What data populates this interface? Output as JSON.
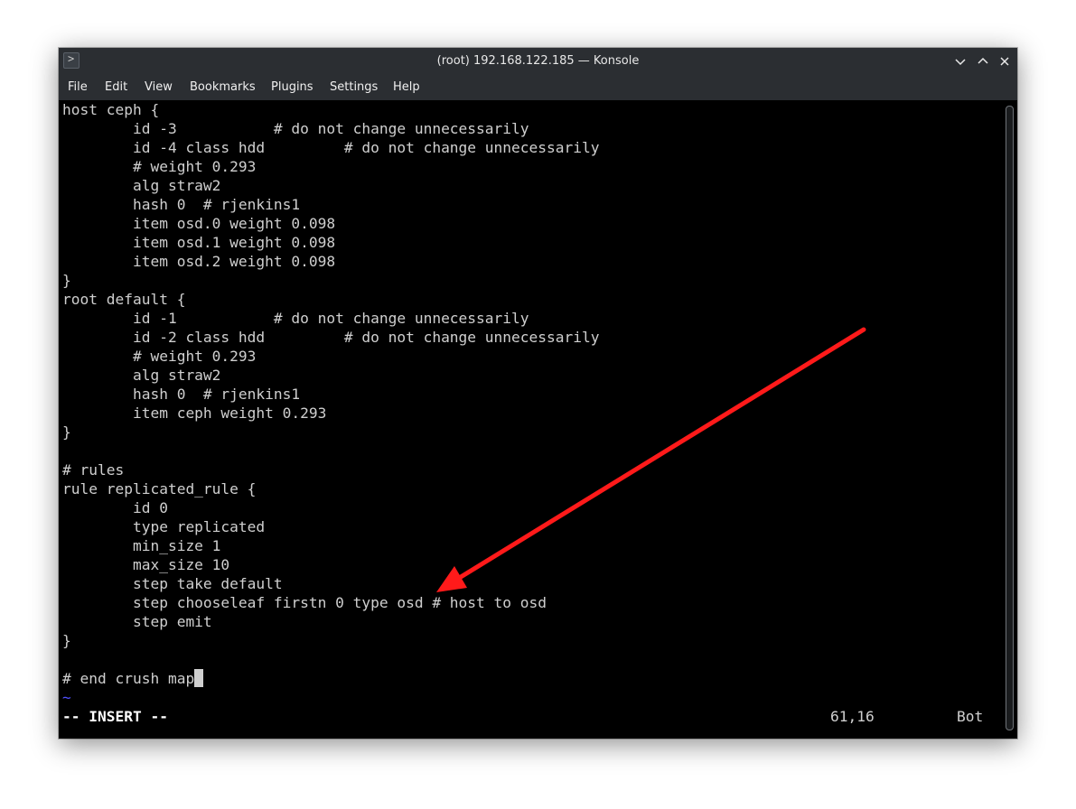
{
  "window": {
    "title": "(root) 192.168.122.185 — Konsole"
  },
  "menu": {
    "file": "File",
    "edit": "Edit",
    "view": "View",
    "bookmarks": "Bookmarks",
    "plugins": "Plugins",
    "settings": "Settings",
    "help": "Help"
  },
  "terminal": {
    "lines": [
      "host ceph {",
      "        id -3           # do not change unnecessarily",
      "        id -4 class hdd         # do not change unnecessarily",
      "        # weight 0.293",
      "        alg straw2",
      "        hash 0  # rjenkins1",
      "        item osd.0 weight 0.098",
      "        item osd.1 weight 0.098",
      "        item osd.2 weight 0.098",
      "}",
      "root default {",
      "        id -1           # do not change unnecessarily",
      "        id -2 class hdd         # do not change unnecessarily",
      "        # weight 0.293",
      "        alg straw2",
      "        hash 0  # rjenkins1",
      "        item ceph weight 0.293",
      "}",
      "",
      "# rules",
      "rule replicated_rule {",
      "        id 0",
      "        type replicated",
      "        min_size 1",
      "        max_size 10",
      "        step take default",
      "        step chooseleaf firstn 0 type osd # host to osd",
      "        step emit",
      "}",
      "",
      "# end crush map",
      "~"
    ]
  },
  "status": {
    "mode": "-- INSERT --",
    "position": "61,16",
    "scroll": "Bot"
  },
  "colors": {
    "arrow": "#ff1a1a",
    "tilde": "#5050ff",
    "text": "#cfcfcf"
  }
}
